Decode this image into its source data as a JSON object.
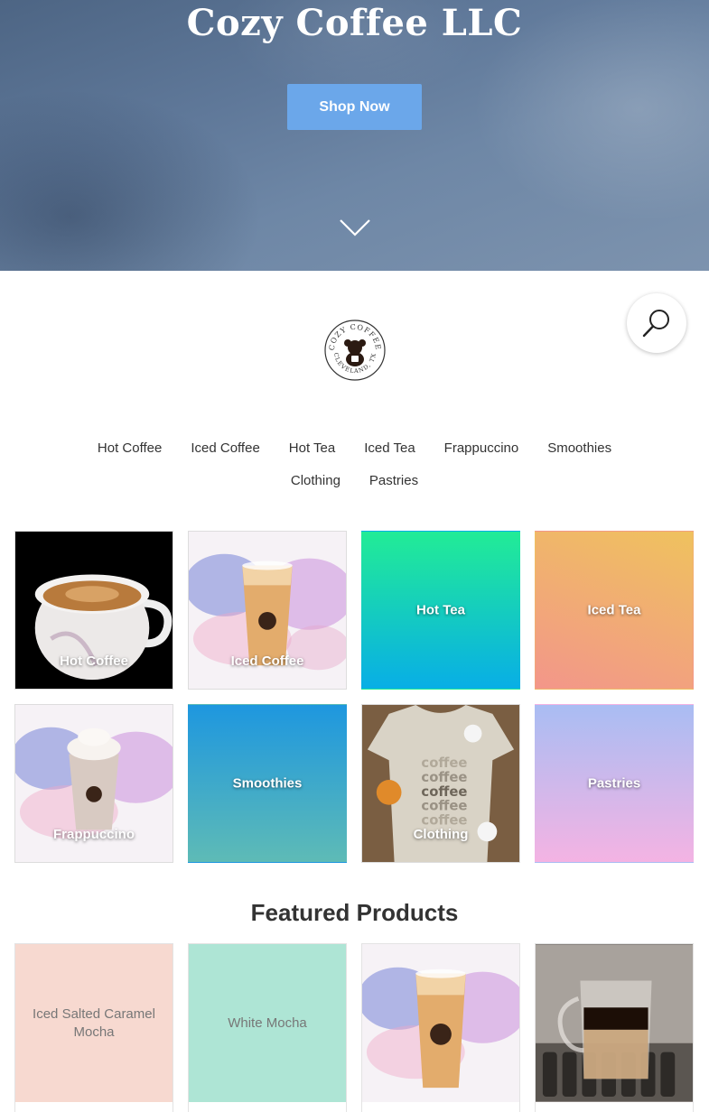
{
  "hero": {
    "title": "Cozy Coffee LLC",
    "shop_button": "Shop Now",
    "scroll_icon": "chevron-down-icon"
  },
  "search": {
    "icon": "search-icon"
  },
  "logo": {
    "top_text": "COZY COFFEE",
    "bottom_text": "CLEVELAND, TX"
  },
  "nav": {
    "row1": [
      "Hot Coffee",
      "Iced Coffee",
      "Hot Tea",
      "Iced Tea",
      "Frappuccino",
      "Smoothies"
    ],
    "row2": [
      "Clothing",
      "Pastries"
    ]
  },
  "categories": [
    {
      "label": "Hot Coffee"
    },
    {
      "label": "Iced Coffee"
    },
    {
      "label": "Hot Tea"
    },
    {
      "label": "Iced Tea"
    },
    {
      "label": "Frappuccino"
    },
    {
      "label": "Smoothies"
    },
    {
      "label": "Clothing"
    },
    {
      "label": "Pastries"
    }
  ],
  "featured": {
    "title": "Featured Products",
    "products": [
      {
        "placeholder": "Iced Salted Caramel Mocha",
        "bg": "#f7d9d0"
      },
      {
        "placeholder": "White Mocha",
        "bg": "#aee5d5"
      },
      {
        "placeholder": ""
      },
      {
        "placeholder": ""
      }
    ]
  },
  "colors": {
    "accent": "#6ba7ea",
    "hot_tea_gradient": [
      "#22ec96",
      "#08aee6"
    ],
    "iced_tea_gradient": [
      "#efc25e",
      "#f3968a"
    ],
    "smoothies_gradient": [
      "#1e97df",
      "#5ebbb6"
    ],
    "pastries_gradient": [
      "#a9bdf3",
      "#f4b3e3"
    ]
  }
}
